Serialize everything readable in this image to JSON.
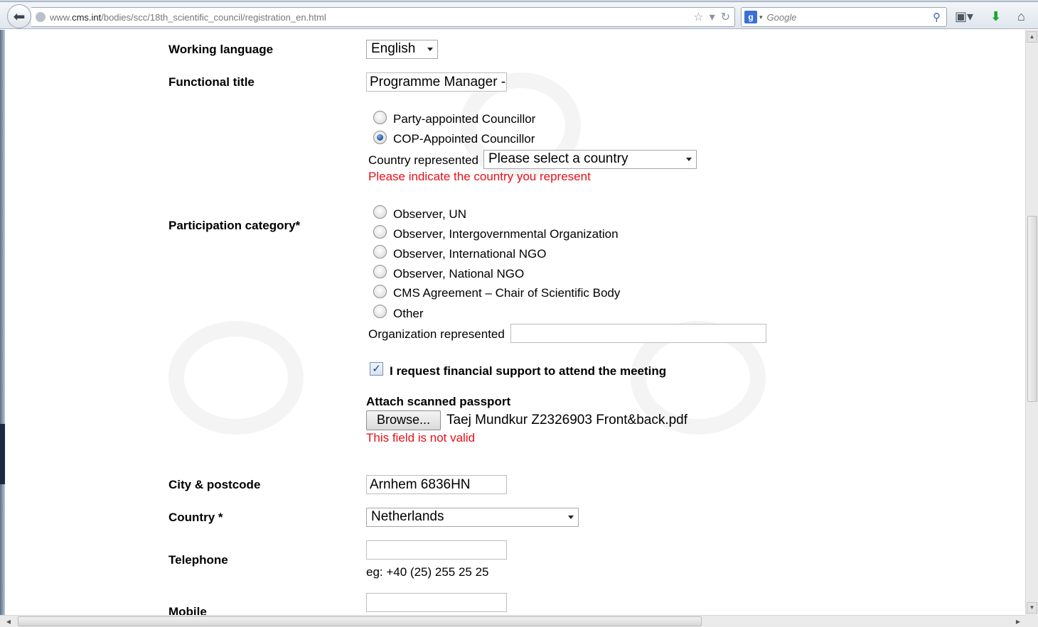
{
  "browser": {
    "url_prefix": "www.",
    "url_domain": "cms.int",
    "url_path": "/bodies/scc/18th_scientific_council/registration_en.html",
    "search_placeholder": "Google",
    "search_engine_letter": "g"
  },
  "form": {
    "working_language": {
      "label": "Working language",
      "value": "English"
    },
    "functional_title": {
      "label": "Functional title",
      "value": "Programme Manager -"
    },
    "councillor": {
      "options": [
        "Party-appointed Councillor",
        "COP-Appointed Councillor"
      ],
      "selected": "COP-Appointed Councillor",
      "country_label": "Country represented",
      "country_value": "Please select a country",
      "error": "Please indicate the country you represent"
    },
    "participation": {
      "label": "Participation category*",
      "options": [
        "Observer, UN",
        "Observer, Intergovernmental Organization",
        "Observer, International NGO",
        "Observer, National NGO",
        "CMS Agreement – Chair of Scientific Body",
        "Other"
      ],
      "org_label": "Organization represented",
      "org_value": ""
    },
    "financial_support": {
      "label": "I request financial support to attend the meeting",
      "checked": true
    },
    "passport": {
      "label": "Attach scanned passport",
      "browse": "Browse...",
      "filename": "Taej Mundkur Z2326903 Front&back.pdf",
      "error": "This field is not valid"
    },
    "city": {
      "label": "City & postcode",
      "value": "Arnhem 6836HN"
    },
    "country": {
      "label": "Country *",
      "value": "Netherlands"
    },
    "telephone": {
      "label": "Telephone",
      "value": "",
      "hint": "eg: +40 (25) 255 25 25"
    },
    "mobile": {
      "label": "Mobile",
      "value": ""
    }
  },
  "colors": {
    "error": "#e8101a",
    "accent": "#1d4f9a"
  }
}
